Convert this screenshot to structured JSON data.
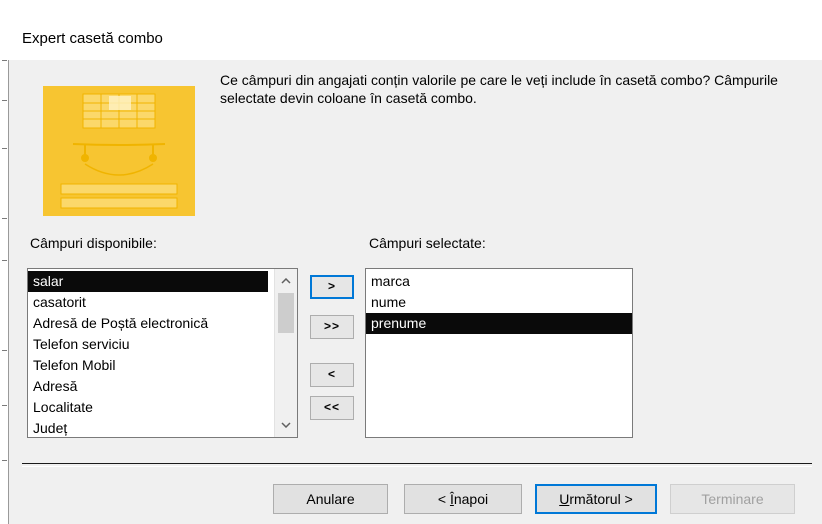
{
  "window": {
    "title": "Expert casetă combo"
  },
  "prompt": "Ce câmpuri din angajati conțin valorile pe care le veți include în casetă combo? Câmpurile selectate devin coloane în casetă combo.",
  "available": {
    "label": "Câmpuri disponibile:",
    "items": [
      "salar",
      "casatorit",
      "Adresă de Poștă electronică",
      "Telefon serviciu",
      "Telefon Mobil",
      "Adresă",
      "Localitate",
      "Județ"
    ],
    "selected_index": 0
  },
  "selected": {
    "label": "Câmpuri selectate:",
    "items": [
      "marca",
      "nume",
      "prenume"
    ],
    "selected_index": 2
  },
  "move_buttons": {
    "add_one": ">",
    "add_all": ">>",
    "remove_one": "<",
    "remove_all": "<<"
  },
  "footer_buttons": {
    "cancel": "Anulare",
    "back_prefix": "< ",
    "back_mnemonic": "Î",
    "back_rest": "napoi",
    "next_mnemonic": "U",
    "next_rest": "rmătorul >",
    "finish": "Terminare"
  },
  "colors": {
    "accent": "#0078d7",
    "illustration": "#f7c531"
  }
}
